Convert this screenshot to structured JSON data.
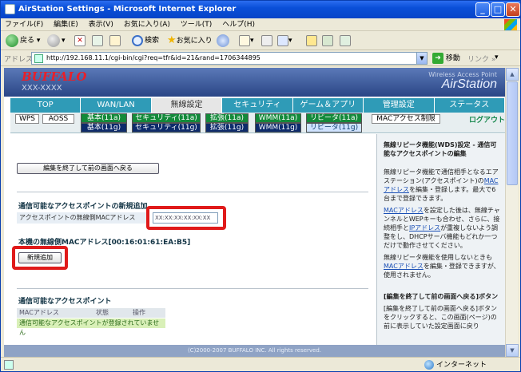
{
  "window": {
    "title": "AirStation Settings - Microsoft Internet Explorer"
  },
  "menubar": {
    "items": [
      "ファイル(F)",
      "編集(E)",
      "表示(V)",
      "お気に入り(A)",
      "ツール(T)",
      "ヘルプ(H)"
    ]
  },
  "toolbar": {
    "back": "戻る",
    "search": "検索",
    "favorites": "お気に入り"
  },
  "address": {
    "label": "アドレス(D)",
    "url": "http://192.168.11.1/cgi-bin/cgi?req=tfr&id=21&rand=1706344895",
    "go": "移動",
    "links": "リンク »"
  },
  "header": {
    "brand": "BUFFALO",
    "model": "XXX-XXXX",
    "tagline": "Wireless Access Point",
    "product": "AirStation"
  },
  "nav": {
    "tabs": [
      "TOP",
      "WAN/LAN",
      "無線設定",
      "セキュリティ",
      "ゲーム＆アプリ",
      "管理設定",
      "ステータス"
    ],
    "active_index": 2
  },
  "subnav": {
    "wps": "WPS",
    "aoss": "AOSS",
    "row1": [
      "基本(11a)",
      "セキュリティ(11a)",
      "拡張(11a)",
      "WMM(11a)",
      "リピータ(11a)"
    ],
    "row2": [
      "基本(11g)",
      "セキュリティ(11g)",
      "拡張(11g)",
      "WMM(11g)",
      "リピータ(11g)"
    ],
    "mac_access": "MACアクセス制限",
    "logout": "ログアウト"
  },
  "main": {
    "edit_end_button": "編集を終了して前の画面へ戻る",
    "add_section_title": "通信可能なアクセスポイントの新規追加",
    "mac_field_label": "アクセスポイントの無線側MACアドレス",
    "mac_field_value": "XX:XX:XX:XX:XX:XX",
    "own_mac": "本機の無線側MACアドレス[00:16:01:61:EA:B5]",
    "add_button": "新規追加",
    "list_section_title": "通信可能なアクセスポイント",
    "table_headers": [
      "MACアドレス",
      "状態",
      "操作"
    ],
    "table_empty": "通信可能なアクセスポイントが登録されていません"
  },
  "footer": {
    "copyright": "(C)2000-2007 BUFFALO INC. All rights reserved."
  },
  "sidebar": {
    "title": "無線リピータ機能(WDS)設定 - 通信可能なアクセスポイントの編集",
    "p1_a": "無線リピータ機能で通信相手となるエアステーション(アクセスポイント)の",
    "p1_link": "MACアドレス",
    "p1_b": "を編集・登録します。最大で6台まで登録できます。",
    "p2_link1": "MACアドレス",
    "p2_a": "を設定した後は、無線チャンネルとWEPキーも合わせ、さらに、接続相手と",
    "p2_link2": "IPアドレス",
    "p2_b": "が重複しないよう調整をし、DHCPサーバ機能もどれか一つだけで動作させてください。",
    "p3_a": "無線リピータ機能を使用しないときも",
    "p3_link": "MACアドレス",
    "p3_b": "を編集・登録できますが、使用されません。",
    "sub_title": "[編集を終了して前の画面へ戻る]ボタン",
    "p4": "[編集を終了して前の画面へ戻る]ボタンをクリックすると、この画面(ページ)の前に表示していた設定画面に戻り"
  },
  "statusbar": {
    "zone": "インターネット"
  }
}
